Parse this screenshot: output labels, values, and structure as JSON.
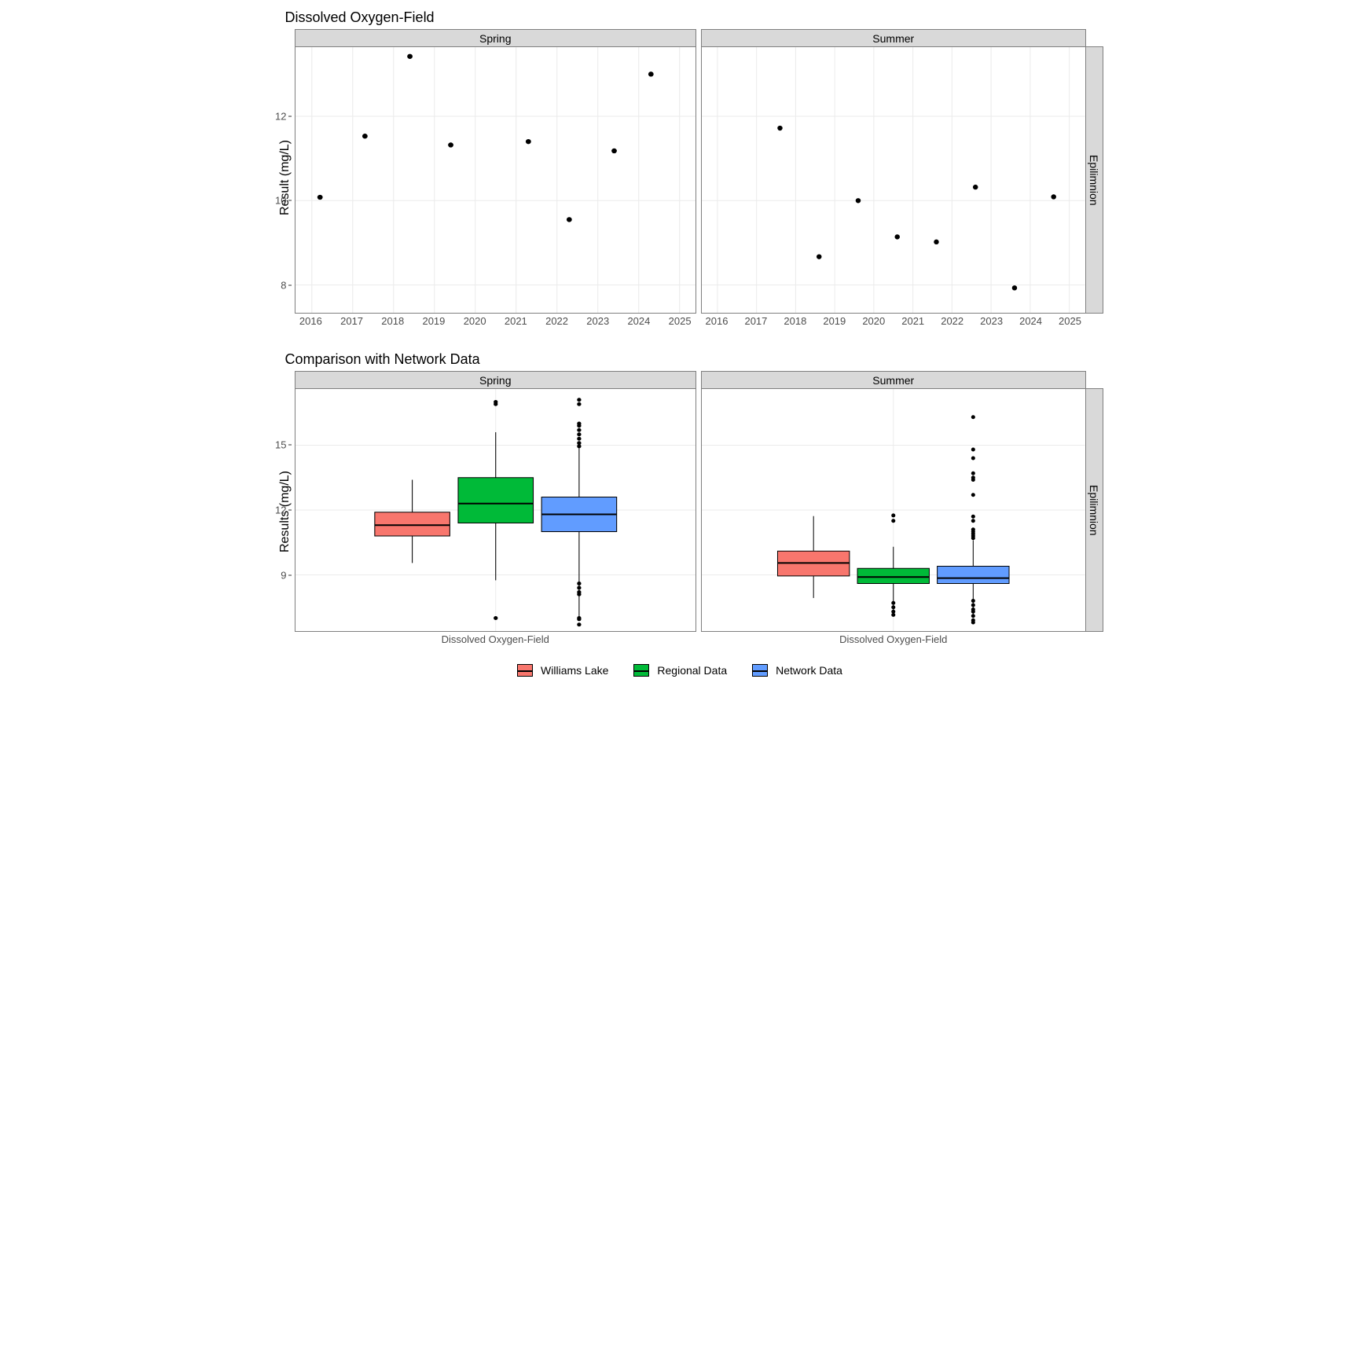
{
  "chart_data": [
    {
      "type": "scatter",
      "title": "Dissolved Oxygen-Field",
      "ylabel": "Result (mg/L)",
      "xlabel": "",
      "facet_right": "Epilimnion",
      "x_ticks": [
        2016,
        2017,
        2018,
        2019,
        2020,
        2021,
        2022,
        2023,
        2024,
        2025
      ],
      "y_ticks": [
        8,
        10,
        12
      ],
      "ylim": [
        7.5,
        13.8
      ],
      "xlim": [
        2015.6,
        2025.4
      ],
      "facets": [
        {
          "label": "Spring",
          "points": [
            {
              "x": 2016.2,
              "y": 10.08
            },
            {
              "x": 2017.3,
              "y": 11.53
            },
            {
              "x": 2018.4,
              "y": 13.42
            },
            {
              "x": 2019.4,
              "y": 11.32
            },
            {
              "x": 2021.3,
              "y": 11.4
            },
            {
              "x": 2022.3,
              "y": 9.55
            },
            {
              "x": 2023.4,
              "y": 11.18
            },
            {
              "x": 2024.3,
              "y": 13.0
            }
          ]
        },
        {
          "label": "Summer",
          "points": [
            {
              "x": 2017.6,
              "y": 11.72
            },
            {
              "x": 2018.6,
              "y": 8.67
            },
            {
              "x": 2019.6,
              "y": 10.0
            },
            {
              "x": 2020.6,
              "y": 9.14
            },
            {
              "x": 2021.6,
              "y": 9.02
            },
            {
              "x": 2022.6,
              "y": 10.32
            },
            {
              "x": 2023.6,
              "y": 7.93
            },
            {
              "x": 2024.6,
              "y": 10.09
            }
          ]
        }
      ]
    },
    {
      "type": "boxplot",
      "title": "Comparison with Network Data",
      "ylabel": "Results (mg/L)",
      "xlabel_cat": "Dissolved Oxygen-Field",
      "facet_right": "Epilimnion",
      "y_ticks": [
        9,
        12,
        15
      ],
      "ylim": [
        6.4,
        17.6
      ],
      "legend": [
        {
          "name": "Williams Lake",
          "color": "#f8766d"
        },
        {
          "name": "Regional Data",
          "color": "#00ba38"
        },
        {
          "name": "Network Data",
          "color": "#619cff"
        }
      ],
      "facets": [
        {
          "label": "Spring",
          "boxes": [
            {
              "series": "Williams Lake",
              "min": 9.55,
              "q1": 10.8,
              "median": 11.3,
              "q3": 11.9,
              "max": 13.4,
              "outliers": []
            },
            {
              "series": "Regional Data",
              "min": 8.75,
              "q1": 11.4,
              "median": 12.3,
              "q3": 13.5,
              "max": 15.6,
              "outliers": [
                17.0,
                16.9,
                7.0
              ]
            },
            {
              "series": "Network Data",
              "min": 7.0,
              "q1": 11.0,
              "median": 11.8,
              "q3": 12.6,
              "max": 15.0,
              "outliers": [
                17.1,
                16.9,
                16.0,
                15.9,
                15.7,
                15.5,
                15.3,
                15.1,
                14.95,
                8.6,
                8.4,
                8.2,
                8.1,
                7.0,
                6.95,
                6.7
              ]
            }
          ]
        },
        {
          "label": "Summer",
          "boxes": [
            {
              "series": "Williams Lake",
              "min": 7.93,
              "q1": 8.95,
              "median": 9.55,
              "q3": 10.1,
              "max": 11.72,
              "outliers": []
            },
            {
              "series": "Regional Data",
              "min": 7.1,
              "q1": 8.6,
              "median": 8.9,
              "q3": 9.3,
              "max": 10.3,
              "outliers": [
                11.75,
                11.5,
                7.7,
                7.5,
                7.3,
                7.15
              ]
            },
            {
              "series": "Network Data",
              "min": 7.1,
              "q1": 8.6,
              "median": 8.85,
              "q3": 9.4,
              "max": 10.6,
              "outliers": [
                16.3,
                14.8,
                14.4,
                13.7,
                13.5,
                13.4,
                12.7,
                11.7,
                11.5,
                11.1,
                11.0,
                10.9,
                10.8,
                10.7,
                7.8,
                7.6,
                7.4,
                7.3,
                7.1,
                6.9,
                6.8
              ]
            }
          ]
        }
      ]
    }
  ],
  "titles": {
    "fig1": "Dissolved Oxygen-Field",
    "fig2": "Comparison with Network Data"
  },
  "axis": {
    "y1": "Result (mg/L)",
    "y2": "Results (mg/L)"
  },
  "x_cat": "Dissolved Oxygen-Field",
  "facets": {
    "spring": "Spring",
    "summer": "Summer",
    "epi": "Epilimnion"
  },
  "legend": {
    "a": "Williams Lake",
    "b": "Regional Data",
    "c": "Network Data"
  },
  "colors": {
    "a": "#f8766d",
    "b": "#00ba38",
    "c": "#619cff"
  },
  "x_years": [
    "2016",
    "2017",
    "2018",
    "2019",
    "2020",
    "2021",
    "2022",
    "2023",
    "2024",
    "2025"
  ],
  "y1_ticks": [
    "8",
    "10",
    "12"
  ],
  "y2_ticks": [
    "9",
    "12",
    "15"
  ]
}
